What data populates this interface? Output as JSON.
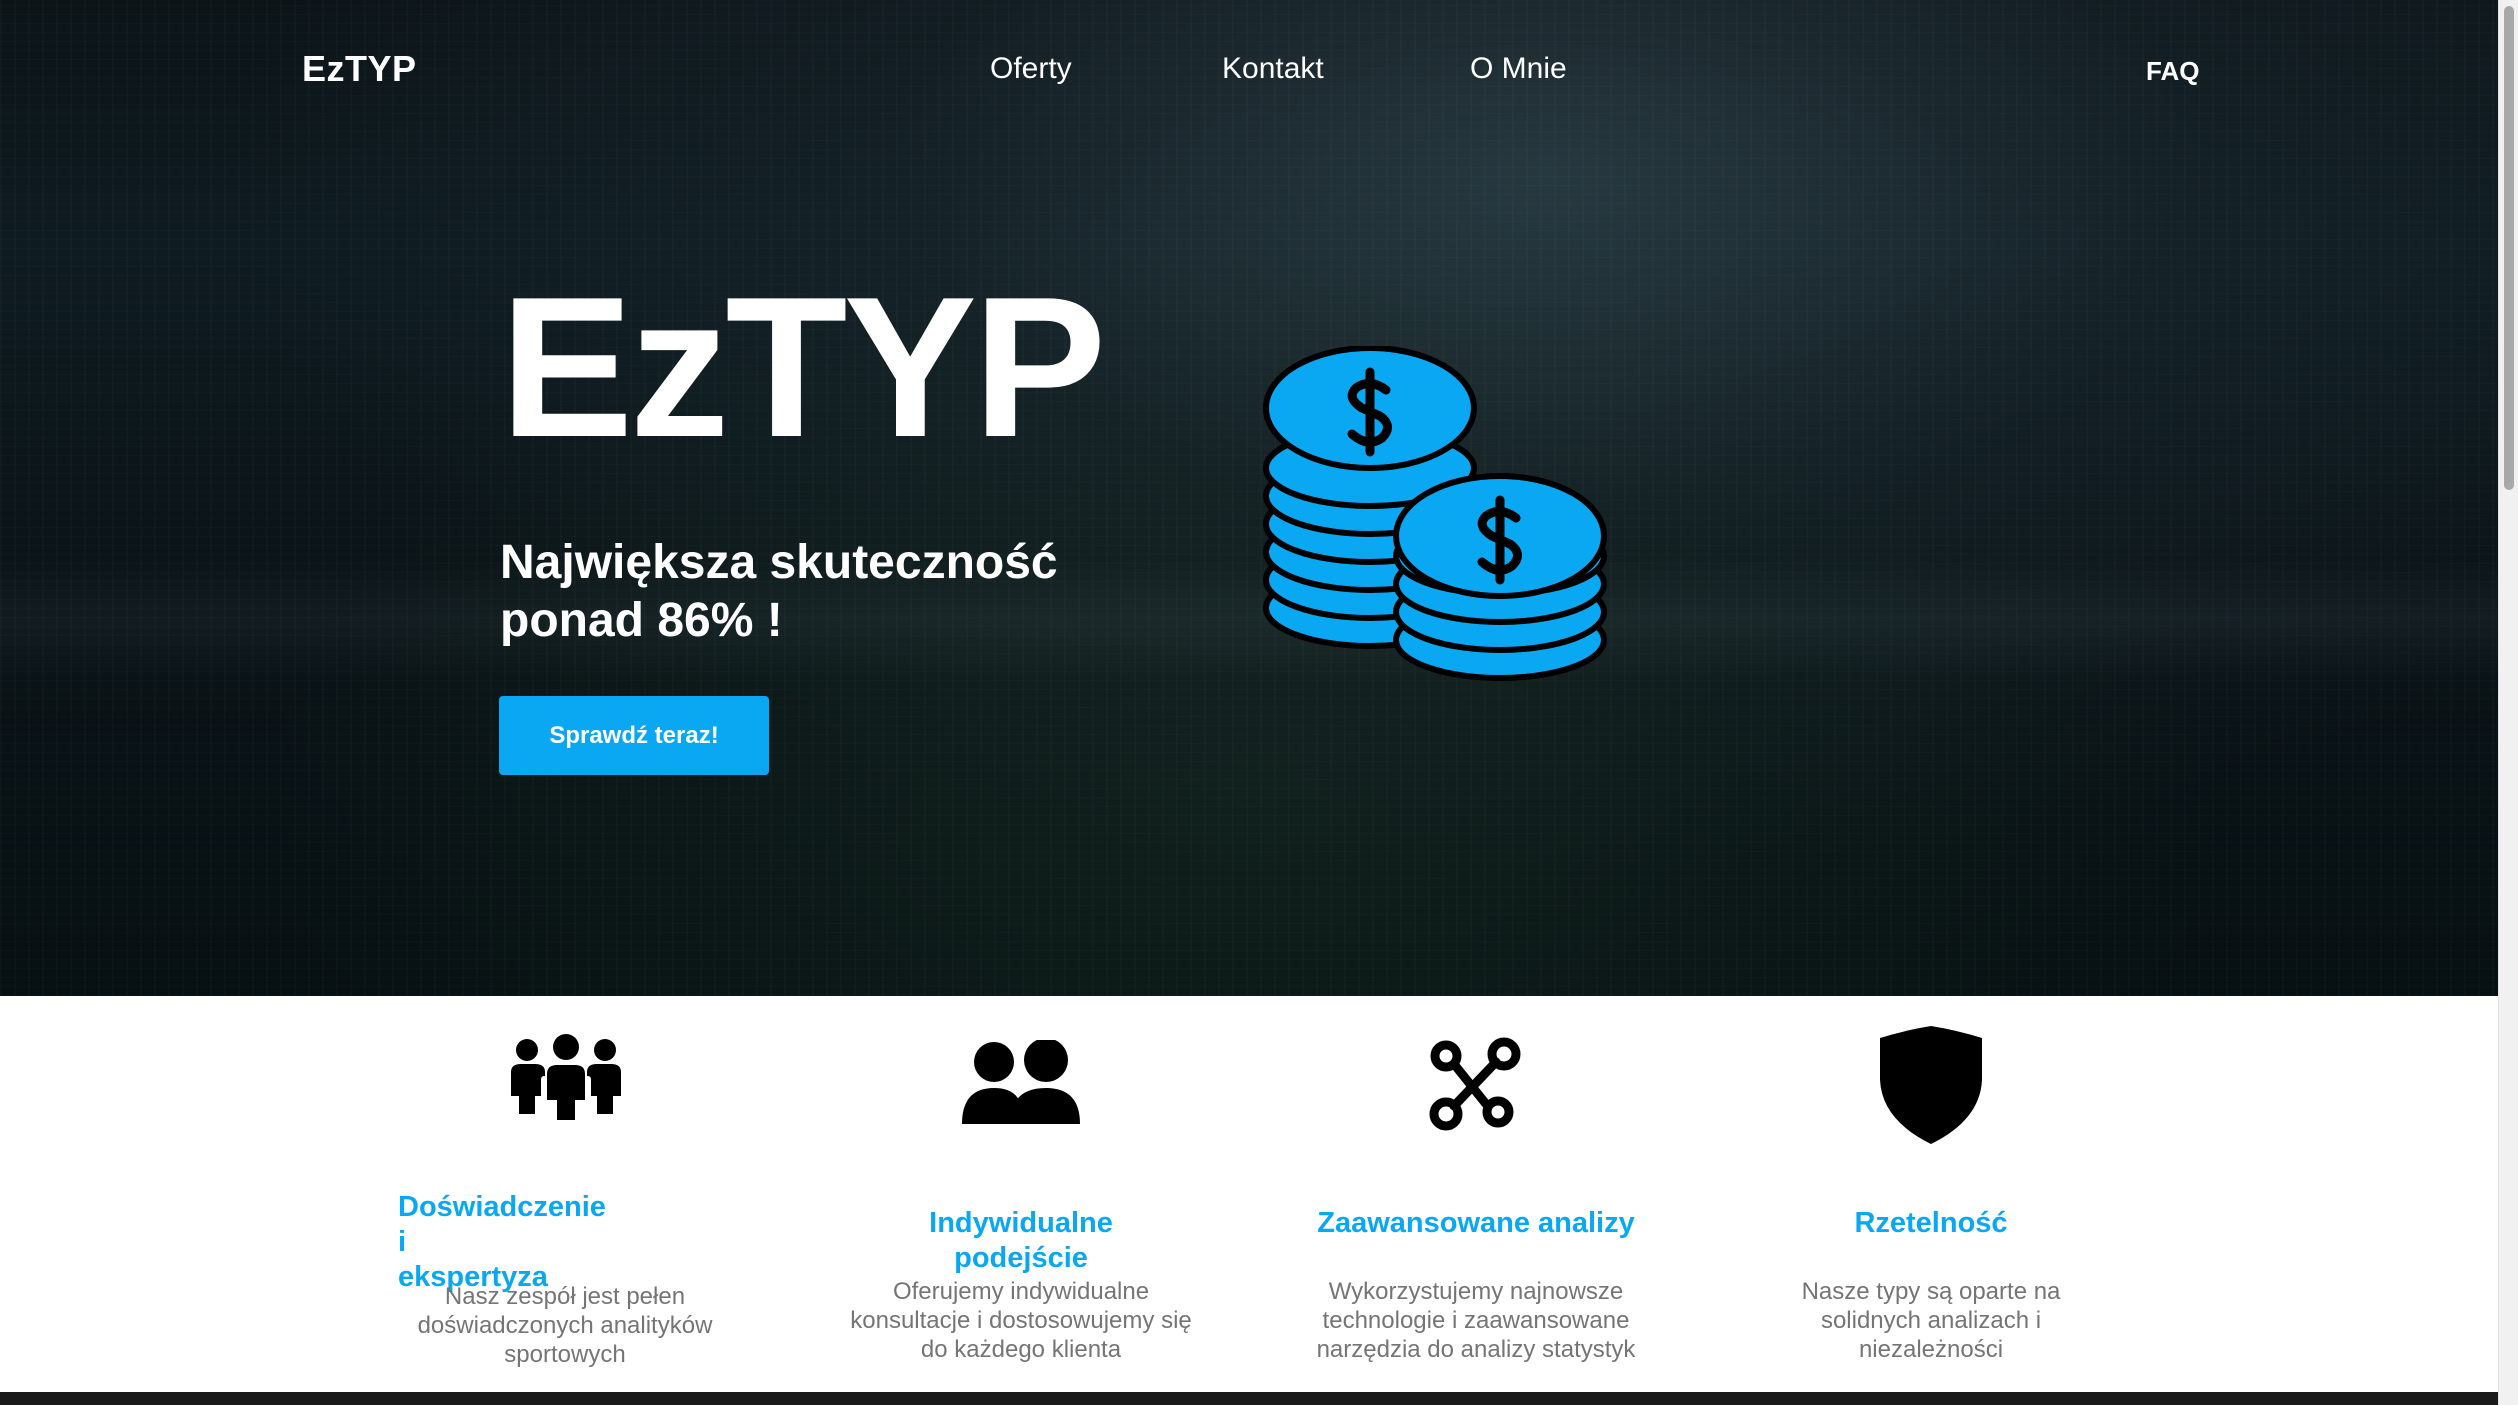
{
  "nav": {
    "logo": "EzTYP",
    "links": [
      "Oferty",
      "Kontakt",
      "O Mnie"
    ],
    "faq": "FAQ"
  },
  "hero": {
    "title": "EzTYP",
    "tagline_line1": "Największa skuteczność",
    "tagline_line2": "ponad 86% !",
    "cta": "Sprawdź teraz!",
    "illustration": "coins-stack-icon"
  },
  "features": [
    {
      "icon": "group-icon",
      "title_line1": "Doświadczenie i",
      "title_line2": "ekspertyza",
      "desc_lines": [
        "Nasz zespół jest pełen",
        "doświadczonych analityków",
        "sportowych"
      ]
    },
    {
      "icon": "users-icon",
      "title_line1": "Indywidualne podejście",
      "title_line2": "",
      "desc_lines": [
        "Oferujemy indywidualne",
        "konsultacje i dostosowujemy się",
        "do każdego klienta"
      ]
    },
    {
      "icon": "analytics-icon",
      "title_line1": "Zaawansowane analizy",
      "title_line2": "",
      "desc_lines": [
        "Wykorzystujemy najnowsze",
        "technologie i zaawansowane",
        "narzędzia do analizy statystyk"
      ]
    },
    {
      "icon": "shield-icon",
      "title_line1": "Rzetelność",
      "title_line2": "",
      "desc_lines": [
        "Nasze typy są oparte na",
        "solidnych analizach i",
        "niezależności"
      ]
    }
  ],
  "colors": {
    "accent": "#0aa8f2",
    "hero_bg": "#0c1418",
    "feature_desc": "#757575"
  }
}
